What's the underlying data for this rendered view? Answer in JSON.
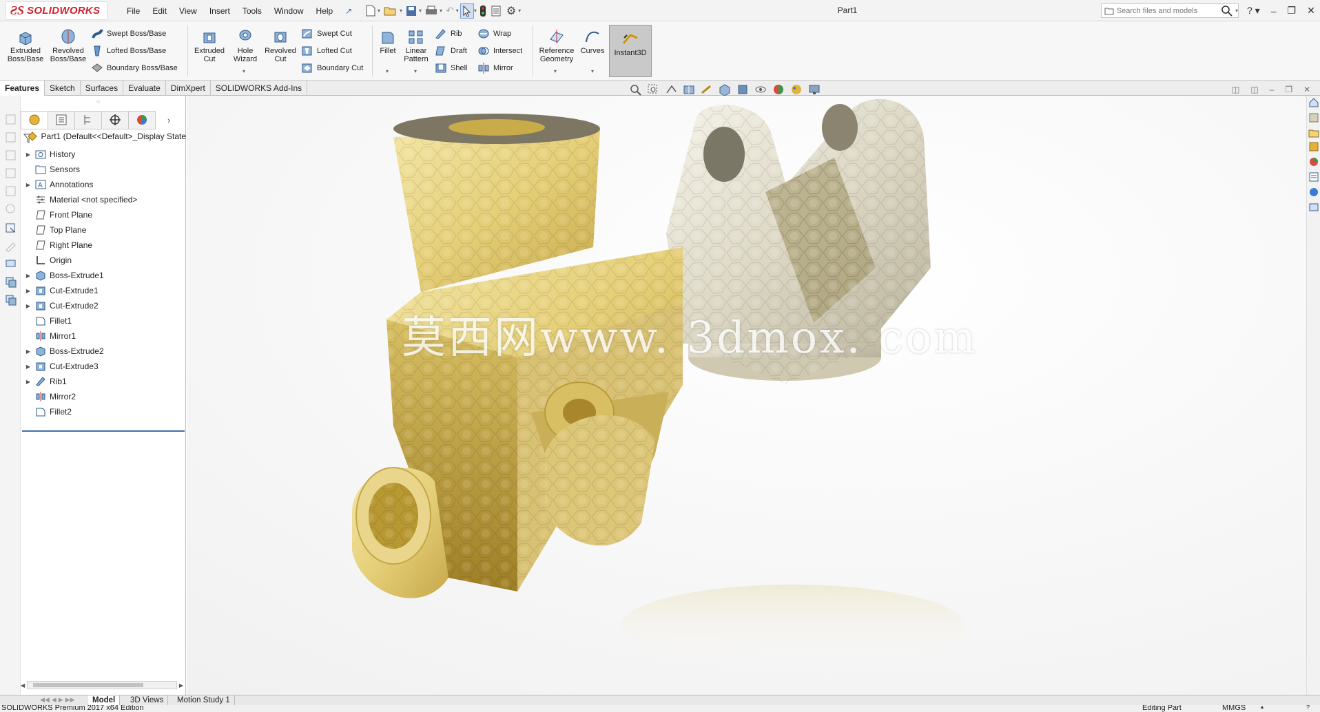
{
  "app": {
    "logo_mark": "ƧS",
    "logo_text": "SOLIDWORKS",
    "title": "Part1"
  },
  "menu": [
    "File",
    "Edit",
    "View",
    "Insert",
    "Tools",
    "Window",
    "Help"
  ],
  "search": {
    "placeholder": "Search files and models"
  },
  "ribbon": {
    "extruded_boss": "Extruded Boss/Base",
    "revolved_boss": "Revolved Boss/Base",
    "swept_boss": "Swept Boss/Base",
    "lofted_boss": "Lofted Boss/Base",
    "boundary_boss": "Boundary Boss/Base",
    "extruded_cut": "Extruded Cut",
    "hole_wizard": "Hole Wizard",
    "revolved_cut": "Revolved Cut",
    "swept_cut": "Swept Cut",
    "lofted_cut": "Lofted Cut",
    "boundary_cut": "Boundary Cut",
    "fillet": "Fillet",
    "linear_pattern": "Linear Pattern",
    "rib": "Rib",
    "draft": "Draft",
    "shell": "Shell",
    "wrap": "Wrap",
    "intersect": "Intersect",
    "mirror": "Mirror",
    "reference_geometry": "Reference Geometry",
    "curves": "Curves",
    "instant3d": "Instant3D"
  },
  "command_tabs": [
    "Features",
    "Sketch",
    "Surfaces",
    "Evaluate",
    "DimXpert",
    "SOLIDWORKS Add-Ins"
  ],
  "tree": {
    "root": "Part1  (Default<<Default>_Display State",
    "items": [
      {
        "label": "History",
        "icon": "history-folder-icon",
        "expandable": true
      },
      {
        "label": "Sensors",
        "icon": "sensors-folder-icon",
        "expandable": false
      },
      {
        "label": "Annotations",
        "icon": "annotations-icon",
        "expandable": true
      },
      {
        "label": "Material <not specified>",
        "icon": "material-icon",
        "expandable": false
      },
      {
        "label": "Front Plane",
        "icon": "plane-icon",
        "expandable": false
      },
      {
        "label": "Top Plane",
        "icon": "plane-icon",
        "expandable": false
      },
      {
        "label": "Right Plane",
        "icon": "plane-icon",
        "expandable": false
      },
      {
        "label": "Origin",
        "icon": "origin-icon",
        "expandable": false
      },
      {
        "label": "Boss-Extrude1",
        "icon": "boss-extrude-icon",
        "expandable": true
      },
      {
        "label": "Cut-Extrude1",
        "icon": "cut-extrude-icon",
        "expandable": true
      },
      {
        "label": "Cut-Extrude2",
        "icon": "cut-extrude-icon",
        "expandable": true
      },
      {
        "label": "Fillet1",
        "icon": "fillet-icon",
        "expandable": false
      },
      {
        "label": "Mirror1",
        "icon": "mirror-icon",
        "expandable": false
      },
      {
        "label": "Boss-Extrude2",
        "icon": "boss-extrude-icon",
        "expandable": true
      },
      {
        "label": "Cut-Extrude3",
        "icon": "cut-extrude-icon",
        "expandable": true
      },
      {
        "label": "Rib1",
        "icon": "rib-icon",
        "expandable": true
      },
      {
        "label": "Mirror2",
        "icon": "mirror-icon",
        "expandable": false
      },
      {
        "label": "Fillet2",
        "icon": "fillet-icon",
        "expandable": false
      }
    ]
  },
  "bottom_tabs": [
    "Model",
    "3D Views",
    "Motion Study 1"
  ],
  "status": {
    "edition": "SOLIDWORKS Premium 2017 x64 Edition",
    "mode": "Editing Part",
    "units": "MMGS"
  },
  "watermark": "莫西网www. 3dmox. com",
  "colors": {
    "brand_red": "#d0202a",
    "active_gray": "#c9c9c9",
    "tree_accent": "#3d6fa8",
    "gold_part": "#e7d58a",
    "silver_part": "#e3e0d2"
  }
}
